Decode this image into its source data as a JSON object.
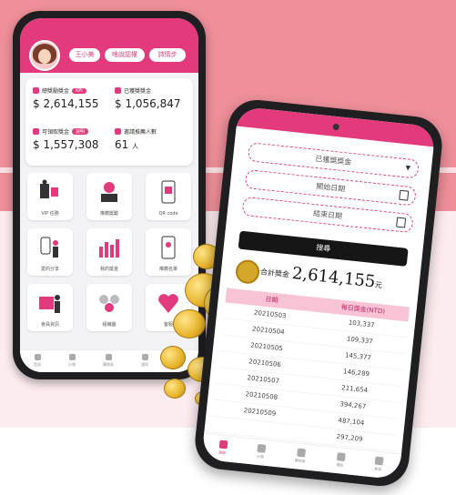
{
  "left_phone": {
    "header": {
      "user_name": "王小美",
      "button_1": "啥說認權",
      "button_2": "詩情步"
    },
    "stats": [
      {
        "label": "總獎勵獎金",
        "tag": "KPI",
        "value": "$ 2,614,155"
      },
      {
        "label": "已獲獎獎金",
        "tag": "",
        "value": "$ 1,056,847"
      },
      {
        "label": "可領取獎金",
        "tag": "說明",
        "value": "$ 1,557,308"
      },
      {
        "label": "邀請推薦人數",
        "tag": "",
        "value": "61",
        "unit": "人"
      }
    ],
    "tiles": [
      "VIP 任務",
      "推薦獎勵",
      "QR code",
      "愛的分享",
      "我的獎金",
      "推薦名單",
      "會員資訊",
      "組織圖",
      "客服"
    ],
    "nav": [
      "首頁",
      "分類",
      "購物車",
      "通知",
      "會員"
    ]
  },
  "right_phone": {
    "fields": {
      "category": "已獲獎獎金",
      "start_date": "開始日期",
      "end_date": "結束日期"
    },
    "search_label": "搜尋",
    "total": {
      "label": "合計獎金",
      "value": "2,614,155",
      "unit": "元"
    },
    "table": {
      "headers": [
        "日期",
        "每日獎金(NTD)"
      ],
      "rows": [
        [
          "20210503",
          "103,337"
        ],
        [
          "20210504",
          "109,337"
        ],
        [
          "20210505",
          "145,377"
        ],
        [
          "20210506",
          "146,289"
        ],
        [
          "20210507",
          "211,654"
        ],
        [
          "20210508",
          "394,267"
        ],
        [
          "20210509",
          "487,104"
        ],
        [
          "",
          "297,209"
        ]
      ]
    },
    "nav": [
      "首頁",
      "分類",
      "購物車",
      "通知",
      "會員"
    ]
  },
  "colors": {
    "accent": "#e23a7c",
    "background": "#ee8f99",
    "coin": "#e7b42a"
  }
}
